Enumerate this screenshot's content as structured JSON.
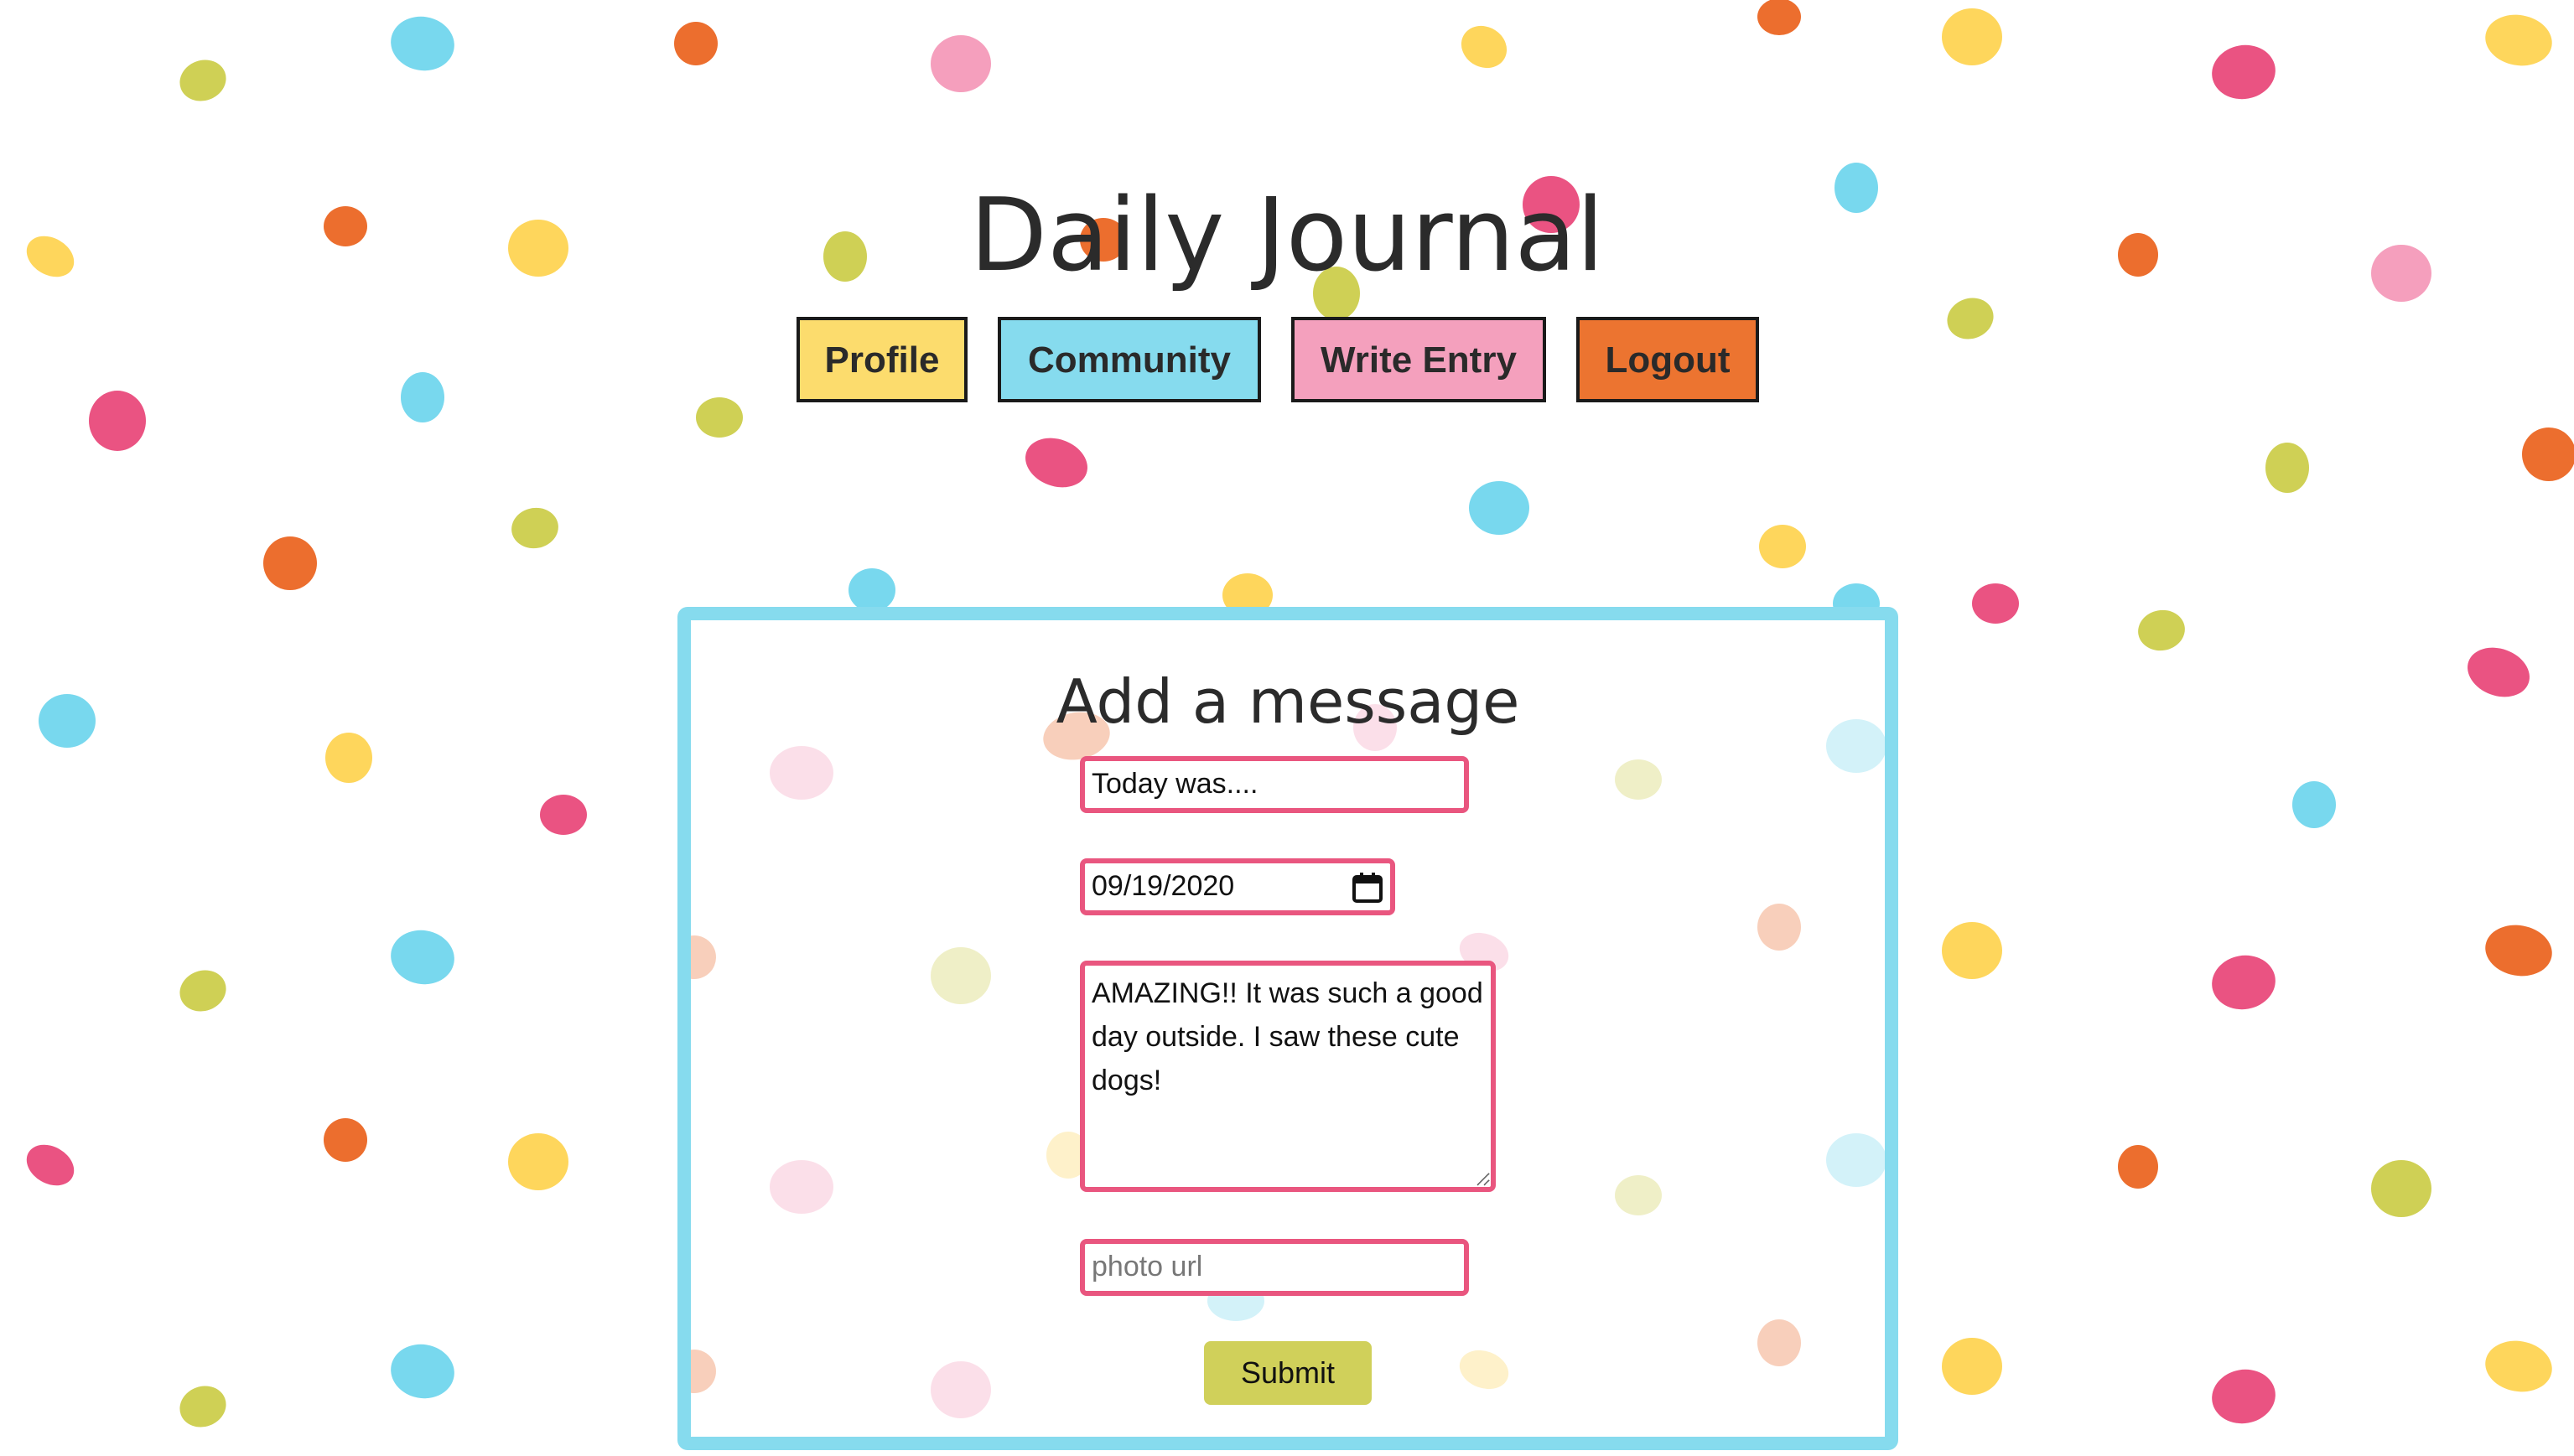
{
  "page": {
    "title": "Daily Journal"
  },
  "nav": {
    "items": [
      {
        "label": "Profile",
        "color": "#fcdc6d"
      },
      {
        "label": "Community",
        "color": "#86dbee"
      },
      {
        "label": "Write Entry",
        "color": "#f4a0bd"
      },
      {
        "label": "Logout",
        "color": "#ec7430"
      }
    ]
  },
  "form": {
    "heading": "Add a message",
    "title_value": "Today was....",
    "date_value": "09/19/2020",
    "message_value": "AMAZING!! It was such a good day outside. I saw these cute dogs!",
    "photo_placeholder": "photo url",
    "submit_label": "Submit"
  },
  "colors": {
    "accent_border": "#86dbee",
    "field_border": "#e9567f",
    "submit_bg": "#d0d05a",
    "dot_palette": [
      "#cfd055",
      "#78d8ee",
      "#ec6e2e",
      "#f59fbd",
      "#fed65c",
      "#ea5382"
    ]
  },
  "icons": {
    "date_picker": "calendar-icon"
  }
}
